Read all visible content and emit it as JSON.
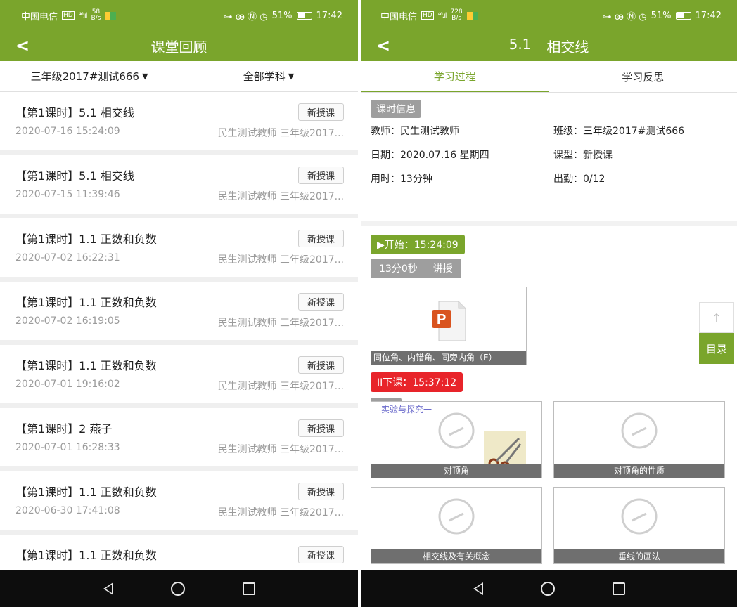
{
  "status_bar": {
    "carrier": "中国电信",
    "hd_icon": "HD",
    "signal": "⁴⁶.ıl",
    "left_speed": {
      "value": "58",
      "unit": "B/s"
    },
    "right_speed": {
      "value": "728",
      "unit": "B/s"
    },
    "right_icons": "⊶ ꙭ Ⓝ ◷",
    "battery": "51%",
    "time": "17:42"
  },
  "left": {
    "title": "课堂回顾",
    "filters": {
      "class": "三年级2017#测试666",
      "subject": "全部学科"
    },
    "lessons": [
      {
        "title": "【第1课时】5.1  相交线",
        "badge": "新授课",
        "date": "2020-07-16 15:24:09",
        "meta": "民生测试教师 三年级2017..."
      },
      {
        "title": "【第1课时】5.1  相交线",
        "badge": "新授课",
        "date": "2020-07-15 11:39:46",
        "meta": "民生测试教师 三年级2017..."
      },
      {
        "title": "【第1课时】1.1 正数和负数",
        "badge": "新授课",
        "date": "2020-07-02 16:22:31",
        "meta": "民生测试教师 三年级2017..."
      },
      {
        "title": "【第1课时】1.1 正数和负数",
        "badge": "新授课",
        "date": "2020-07-02 16:19:05",
        "meta": "民生测试教师 三年级2017..."
      },
      {
        "title": "【第1课时】1.1 正数和负数",
        "badge": "新授课",
        "date": "2020-07-01 19:16:02",
        "meta": "民生测试教师 三年级2017..."
      },
      {
        "title": "【第1课时】2 燕子",
        "badge": "新授课",
        "date": "2020-07-01 16:28:33",
        "meta": "民生测试教师 三年级2017..."
      },
      {
        "title": "【第1课时】1.1 正数和负数",
        "badge": "新授课",
        "date": "2020-06-30 17:41:08",
        "meta": "民生测试教师 三年级2017..."
      },
      {
        "title": "【第1课时】1.1 正数和负数",
        "badge": "新授课",
        "date": "",
        "meta": ""
      }
    ]
  },
  "right": {
    "title_num": "5.1",
    "title_name": "相交线",
    "tabs": [
      "学习过程",
      "学习反思"
    ],
    "info_tag": "课时信息",
    "info": {
      "teacher": "教师：民生测试教师",
      "class": "班级：三年级2017#测试666",
      "date": "日期：2020.07.16 星期四",
      "type": "课型：新授课",
      "duration": "用时：13分钟",
      "attendance": "出勤：0/12"
    },
    "start": "▶开始：15:24:09",
    "segment": {
      "time": "13分0秒",
      "kind": "讲授"
    },
    "ppt_caption": "同位角、内错角、同旁内角（E）",
    "end": "II下课：15:37:12",
    "extend_tag": "拓展",
    "videos": [
      {
        "caption": "对顶角",
        "thumb_text": "实验与探究一"
      },
      {
        "caption": "对顶角的性质",
        "thumb_text": ""
      },
      {
        "caption": "相交线及有关概念",
        "thumb_text": ""
      },
      {
        "caption": "垂线的画法",
        "thumb_text": ""
      }
    ],
    "float_up": "↑",
    "float_menu": "目录"
  },
  "colors": {
    "brand": "#7aa52c",
    "danger": "#e8242a",
    "tag_gray": "#9e9e9e"
  },
  "icons": [
    "back-icon",
    "caret-down-icon",
    "ppt-file-icon",
    "play-circle-icon",
    "scissors-icon",
    "arrow-up-icon",
    "nav-back-icon",
    "nav-home-icon",
    "nav-recent-icon"
  ]
}
